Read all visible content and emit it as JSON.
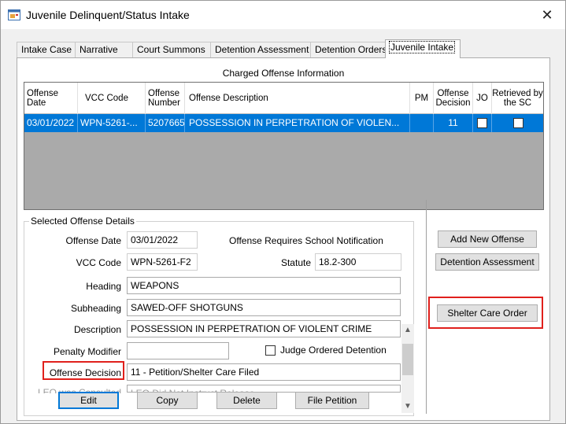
{
  "window": {
    "title": "Juvenile Delinquent/Status Intake",
    "close_glyph": "✕",
    "icon": "app-window-icon"
  },
  "tabs": [
    {
      "label": "Intake Case",
      "active": false
    },
    {
      "label": "Narrative",
      "active": false
    },
    {
      "label": "Court Summons",
      "active": false
    },
    {
      "label": "Detention Assessment",
      "active": false
    },
    {
      "label": "Detention Orders",
      "active": false
    },
    {
      "label": "Juvenile Intake",
      "active": true
    }
  ],
  "charged_offense": {
    "section_title": "Charged Offense Information",
    "columns": [
      "Offense Date",
      "VCC Code",
      "Offense Number",
      "Offense Description",
      "PM",
      "Offense Decision",
      "JO",
      "Retrieved by the SC"
    ],
    "rows": [
      {
        "offense_date": "03/01/2022",
        "vcc_code": "WPN-5261-...",
        "offense_number": "5207665",
        "description": "POSSESSION IN PERPETRATION OF VIOLEN...",
        "pm": "",
        "decision": "11",
        "jo_checked": false,
        "retrieved_checked": false
      }
    ]
  },
  "selected_offense": {
    "group_label": "Selected Offense Details",
    "offense_date_label": "Offense Date",
    "offense_date": "03/01/2022",
    "school_notification_label": "Offense Requires School Notification",
    "vcc_code_label": "VCC Code",
    "vcc_code": "WPN-5261-F2",
    "statute_label": "Statute",
    "statute": "18.2-300",
    "heading_label": "Heading",
    "heading": "WEAPONS",
    "subheading_label": "Subheading",
    "subheading": "SAWED-OFF SHOTGUNS",
    "description_label": "Description",
    "description": "POSSESSION IN PERPETRATION OF VIOLENT CRIME",
    "penalty_modifier_label": "Penalty Modifier",
    "penalty_modifier": "",
    "judge_ordered_label": "Judge Ordered Detention",
    "judge_ordered_checked": false,
    "offense_decision_label": "Offense Decision",
    "offense_decision": "11 - Petition/Shelter Care Filed",
    "leo_consulted_label": "LEO was Consulted",
    "leo_consulted": "LEO Did Not Instruct Release"
  },
  "actions": {
    "edit": "Edit",
    "copy": "Copy",
    "delete": "Delete",
    "file_petition": "File Petition",
    "add_new_offense": "Add New Offense",
    "detention_assessment": "Detention Assessment",
    "shelter_care_order": "Shelter Care Order"
  },
  "colors": {
    "selection": "#0078d7",
    "highlight_box": "#e0201c",
    "grid_background": "#aaaaaa"
  }
}
